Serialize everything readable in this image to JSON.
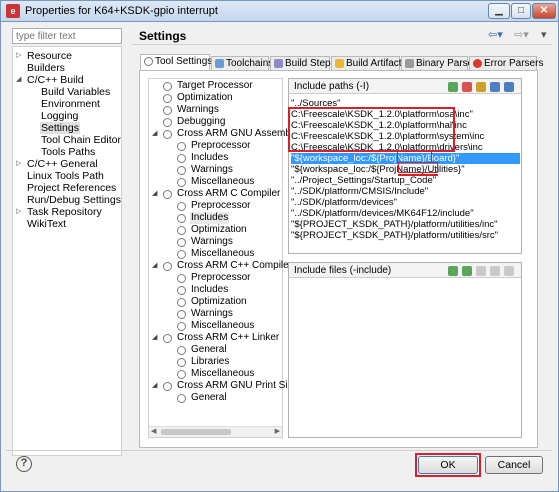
{
  "window": {
    "title": "Properties for K64+KSDK-gpio interrupt"
  },
  "filter": {
    "placeholder": "type filter text"
  },
  "nav": {
    "items": [
      {
        "label": "Resource",
        "expandable": true
      },
      {
        "label": "Builders"
      },
      {
        "label": "C/C++ Build",
        "expanded": true
      },
      {
        "label": "Build Variables"
      },
      {
        "label": "Environment"
      },
      {
        "label": "Logging"
      },
      {
        "label": "Settings",
        "selected": true
      },
      {
        "label": "Tool Chain Editor"
      },
      {
        "label": "Tools Paths"
      },
      {
        "label": "C/C++ General",
        "expandable": true
      },
      {
        "label": "Linux Tools Path"
      },
      {
        "label": "Project References"
      },
      {
        "label": "Run/Debug Settings"
      },
      {
        "label": "Task Repository",
        "expandable": true
      },
      {
        "label": "WikiText"
      }
    ]
  },
  "page": {
    "title": "Settings"
  },
  "tabs": [
    {
      "label": "Tool Settings",
      "active": true,
      "icon": "gear-icon"
    },
    {
      "label": "Toolchains",
      "icon": "toolchain-icon"
    },
    {
      "label": "Build Steps",
      "icon": "build-steps-icon"
    },
    {
      "label": "Build Artifact",
      "icon": "artifact-icon"
    },
    {
      "label": "Binary Parsers",
      "icon": "binary-icon"
    },
    {
      "label": "Error Parsers",
      "icon": "error-icon"
    }
  ],
  "tooltree": {
    "items": [
      {
        "label": "Target Processor",
        "level": 1
      },
      {
        "label": "Optimization",
        "level": 1
      },
      {
        "label": "Warnings",
        "level": 1
      },
      {
        "label": "Debugging",
        "level": 1
      },
      {
        "label": "Cross ARM GNU Assembler",
        "level": 0
      },
      {
        "label": "Preprocessor",
        "level": 2
      },
      {
        "label": "Includes",
        "level": 2
      },
      {
        "label": "Warnings",
        "level": 2
      },
      {
        "label": "Miscellaneous",
        "level": 2
      },
      {
        "label": "Cross ARM C Compiler",
        "level": 0
      },
      {
        "label": "Preprocessor",
        "level": 2
      },
      {
        "label": "Includes",
        "level": 2,
        "selected": true
      },
      {
        "label": "Optimization",
        "level": 2
      },
      {
        "label": "Warnings",
        "level": 2
      },
      {
        "label": "Miscellaneous",
        "level": 2
      },
      {
        "label": "Cross ARM C++ Compiler",
        "level": 0
      },
      {
        "label": "Preprocessor",
        "level": 2
      },
      {
        "label": "Includes",
        "level": 2
      },
      {
        "label": "Optimization",
        "level": 2
      },
      {
        "label": "Warnings",
        "level": 2
      },
      {
        "label": "Miscellaneous",
        "level": 2
      },
      {
        "label": "Cross ARM C++ Linker",
        "level": 0
      },
      {
        "label": "General",
        "level": 2
      },
      {
        "label": "Libraries",
        "level": 2
      },
      {
        "label": "Miscellaneous",
        "level": 2
      },
      {
        "label": "Cross ARM GNU Print Size",
        "level": 0
      },
      {
        "label": "General",
        "level": 2
      }
    ]
  },
  "include_paths": {
    "header": "Include paths (-I)",
    "items": [
      "\"../Sources\"",
      "C:\\Freescale\\KSDK_1.2.0\\platform\\osa\\inc\"",
      "C:\\Freescale\\KSDK_1.2.0\\platform\\hal\\inc",
      "C:\\Freescale\\KSDK_1.2.0\\platform\\system\\inc",
      "C:\\Freescale\\KSDK_1.2.0\\platform\\drivers\\inc",
      "\"${workspace_loc:/${ProjName}/Board}\"",
      "\"${workspace_loc:/${ProjName}/Utilities}\"",
      "\"../Project_Settings/Startup_Code\"",
      "\"../SDK/platform/CMSIS/Include\"",
      "\"../SDK/platform/devices\"",
      "\"../SDK/platform/devices/MK64F12/include\"",
      "\"${PROJECT_KSDK_PATH}/platform/utilities/inc\"",
      "\"${PROJECT_KSDK_PATH}/platform/utilities/src\""
    ],
    "selected_index": 5
  },
  "include_files": {
    "header": "Include files (-include)"
  },
  "buttons": {
    "ok": "OK",
    "cancel": "Cancel"
  },
  "colors": {
    "selection": "#3399ff",
    "annotation": "#d9202a"
  }
}
